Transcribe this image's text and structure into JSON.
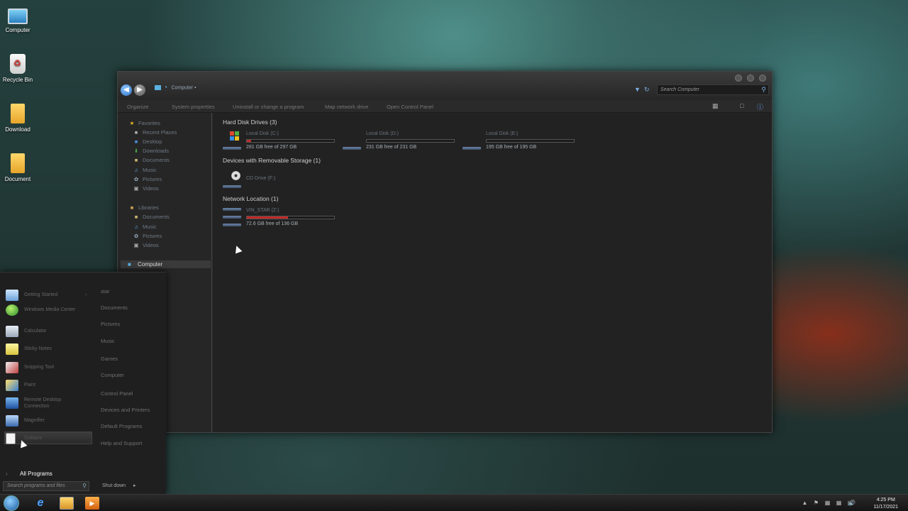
{
  "desktop": {
    "icons": [
      {
        "label": "Computer"
      },
      {
        "label": "Recycle Bin"
      },
      {
        "label": "Download"
      },
      {
        "label": "Document"
      }
    ]
  },
  "explorer": {
    "address": "Computer",
    "search_placeholder": "Search Computer",
    "toolbar": {
      "organize": "Organize",
      "system_properties": "System properties",
      "uninstall": "Uninstall or change a program",
      "map_drive": "Map network drive",
      "control_panel": "Open Control Panel"
    },
    "nav": {
      "favorites": "Favorites",
      "recent_places": "Recent Places",
      "desktop": "Desktop",
      "downloads": "Downloads",
      "documents": "Documents",
      "music": "Music",
      "pictures": "Pictures",
      "videos": "Videos",
      "libraries": "Libraries",
      "lib_documents": "Documents",
      "lib_music": "Music",
      "lib_pictures": "Pictures",
      "lib_videos": "Videos",
      "computer": "Computer"
    },
    "groups": {
      "hard_disks": "Hard Disk Drives (3)",
      "removable": "Devices with Removable Storage (1)",
      "network": "Network Location (1)"
    },
    "drives": [
      {
        "name": "Local Disk (C:)",
        "free": "281 GB free of 297 GB",
        "used_fraction": 0.05,
        "color": "#c02828"
      },
      {
        "name": "Local Disk (D:)",
        "free": "231 GB free of 231 GB",
        "used_fraction": 0.0,
        "color": "#c02828"
      },
      {
        "name": "Local Disk (E:)",
        "free": "195 GB free of 195 GB",
        "used_fraction": 0.0,
        "color": "#c02828"
      },
      {
        "name": "CD Drive (F:)"
      },
      {
        "name": "VIN_STAR (Z:)",
        "free": "72.6 GB free of 136 GB",
        "used_fraction": 0.47,
        "color": "#c02828"
      }
    ]
  },
  "start_menu": {
    "programs": [
      {
        "label": "Getting Started"
      },
      {
        "label": "Windows Media Center"
      },
      {
        "label": "Calculator"
      },
      {
        "label": "Sticky Notes"
      },
      {
        "label": "Snipping Tool"
      },
      {
        "label": "Paint"
      },
      {
        "label": "Remote Desktop"
      },
      {
        "label": "Connection"
      },
      {
        "label": "Magnifier"
      },
      {
        "label": "Solitaire"
      }
    ],
    "right": [
      {
        "label": "star"
      },
      {
        "label": "Documents"
      },
      {
        "label": "Pictures"
      },
      {
        "label": "Music"
      },
      {
        "label": "Games"
      },
      {
        "label": "Computer"
      },
      {
        "label": "Control Panel"
      },
      {
        "label": "Devices and Printers"
      },
      {
        "label": "Default Programs"
      },
      {
        "label": "Help and Support"
      }
    ],
    "all_programs": "All Programs",
    "search_placeholder": "Search programs and files",
    "shutdown": "Shut down"
  },
  "taskbar": {
    "time": "4:25 PM",
    "date": "11/17/2021"
  }
}
